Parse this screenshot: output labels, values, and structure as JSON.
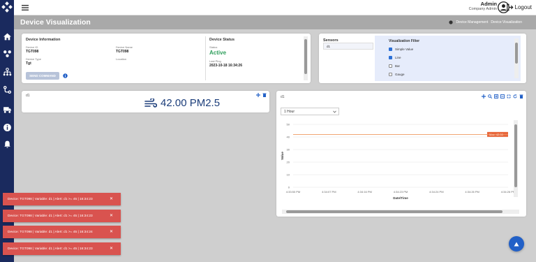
{
  "colors": {
    "rail": "#1a2a5e",
    "accent": "#2260c7",
    "status_active": "#2e9e5b",
    "alert_red": "#d9534f",
    "threshold_line": "#e8873a",
    "chart_line": "#f0a070"
  },
  "topbar": {
    "user_name": "Admin",
    "user_role": "Company Admin",
    "logout_label": "Logout",
    "icons": [
      "menu-icon",
      "user-avatar-icon",
      "logout-icon"
    ]
  },
  "header": {
    "title": "Device Visualization",
    "breadcrumbs": [
      "Device Management",
      "Device Visualization"
    ]
  },
  "sidebar": {
    "icons": [
      "logo-icon",
      "home-icon",
      "devices-icon",
      "hierarchy-icon",
      "flow-icon",
      "vehicle-icon",
      "info-icon",
      "bell-icon"
    ]
  },
  "device_info": {
    "title": "Device Information",
    "device_id_label": "Device ID",
    "device_id": "TGT098",
    "device_name_label": "Device Name",
    "device_name": "TGT098",
    "device_type_label": "Device Type",
    "device_type": "Tgt",
    "location_label": "Location",
    "location": "",
    "send_command_label": "SEND COMMAND"
  },
  "device_status": {
    "title": "Device Status",
    "status_label": "Status",
    "status": "Active",
    "last_ping_label": "Last Ping",
    "last_ping": "2023-10-18 16:34:26"
  },
  "sensors": {
    "title": "Sensors",
    "items": [
      "d1"
    ]
  },
  "visualization_filter": {
    "title": "Visualization Filter",
    "options": [
      {
        "label": "Simple Value",
        "checked": true
      },
      {
        "label": "Line",
        "checked": true
      },
      {
        "label": "Bar",
        "checked": false
      },
      {
        "label": "Gauge",
        "checked": false
      }
    ]
  },
  "value_card": {
    "label": "d1",
    "value": "42.00 PM2.5"
  },
  "chart_card": {
    "label": "d1",
    "range": "1 Hour"
  },
  "chart_data": {
    "type": "line",
    "title": "",
    "xlabel": "Date/Time",
    "ylabel": "Value",
    "x_ticks": [
      "4:33:50 PM",
      "4:34:07 PM",
      "4:34:16 PM",
      "4:34:23 PM",
      "4:34:24 PM",
      "4:34:26 PM",
      "4:34:26 PM"
    ],
    "y_ticks": [
      0,
      10,
      20,
      30,
      40,
      50
    ],
    "ylim": [
      0,
      50
    ],
    "series": [
      {
        "values": [
          42,
          42,
          42,
          42,
          42,
          42,
          42
        ]
      }
    ],
    "threshold": {
      "value": 42,
      "label": "Max: 42.00"
    },
    "grid": true
  },
  "alerts": [
    "Device: TGT098 | Variable: d1 | Alert: d1 >= 45 | 16:34:23",
    "Device: TGT098 | Variable: d1 | Alert: d1 >= 45 | 16:34:23",
    "Device: TGT098 | Variable: d1 | Alert: d1 >= 45 | 16:34:24",
    "Device: TGT098 | Variable: d1 | Alert: d1 >= 45 | 16:34:23"
  ],
  "alert_close": "✕"
}
